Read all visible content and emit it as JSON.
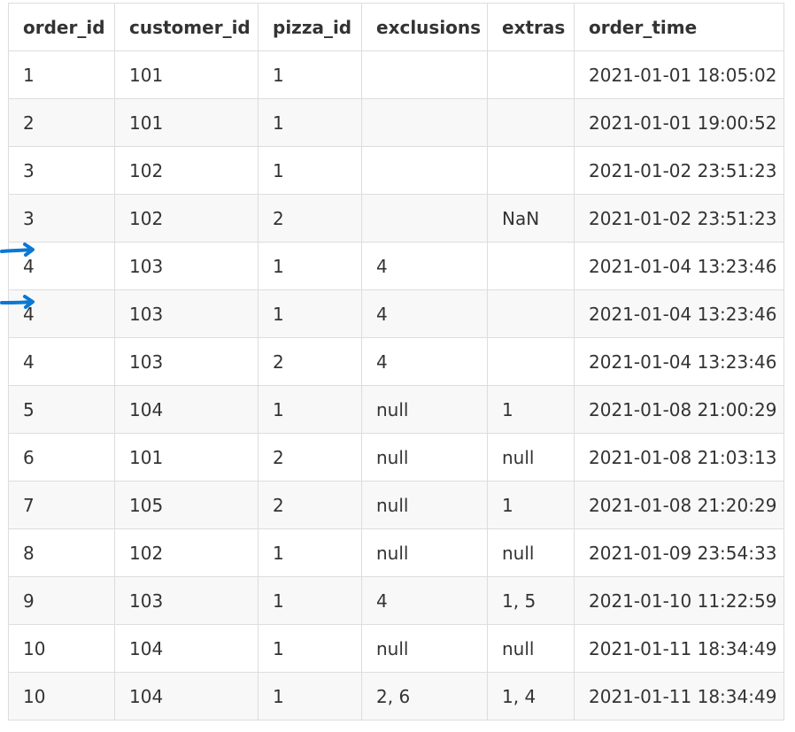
{
  "table": {
    "columns": [
      "order_id",
      "customer_id",
      "pizza_id",
      "exclusions",
      "extras",
      "order_time"
    ],
    "rows": [
      [
        "1",
        "101",
        "1",
        "",
        "",
        "2021-01-01 18:05:02"
      ],
      [
        "2",
        "101",
        "1",
        "",
        "",
        "2021-01-01 19:00:52"
      ],
      [
        "3",
        "102",
        "1",
        "",
        "",
        "2021-01-02 23:51:23"
      ],
      [
        "3",
        "102",
        "2",
        "",
        "NaN",
        "2021-01-02 23:51:23"
      ],
      [
        "4",
        "103",
        "1",
        "4",
        "",
        "2021-01-04 13:23:46"
      ],
      [
        "4",
        "103",
        "1",
        "4",
        "",
        "2021-01-04 13:23:46"
      ],
      [
        "4",
        "103",
        "2",
        "4",
        "",
        "2021-01-04 13:23:46"
      ],
      [
        "5",
        "104",
        "1",
        "null",
        "1",
        "2021-01-08 21:00:29"
      ],
      [
        "6",
        "101",
        "2",
        "null",
        "null",
        "2021-01-08 21:03:13"
      ],
      [
        "7",
        "105",
        "2",
        "null",
        "1",
        "2021-01-08 21:20:29"
      ],
      [
        "8",
        "102",
        "1",
        "null",
        "null",
        "2021-01-09 23:54:33"
      ],
      [
        "9",
        "103",
        "1",
        "4",
        "1, 5",
        "2021-01-10 11:22:59"
      ],
      [
        "10",
        "104",
        "1",
        "null",
        "null",
        "2021-01-11 18:34:49"
      ],
      [
        "10",
        "104",
        "1",
        "2, 6",
        "1, 4",
        "2021-01-11 18:34:49"
      ]
    ]
  },
  "annotations": {
    "arrow_color": "#0a78d4",
    "arrow_icon": "hand-drawn-arrow-icon",
    "marked_row_indices": [
      4,
      5
    ]
  }
}
